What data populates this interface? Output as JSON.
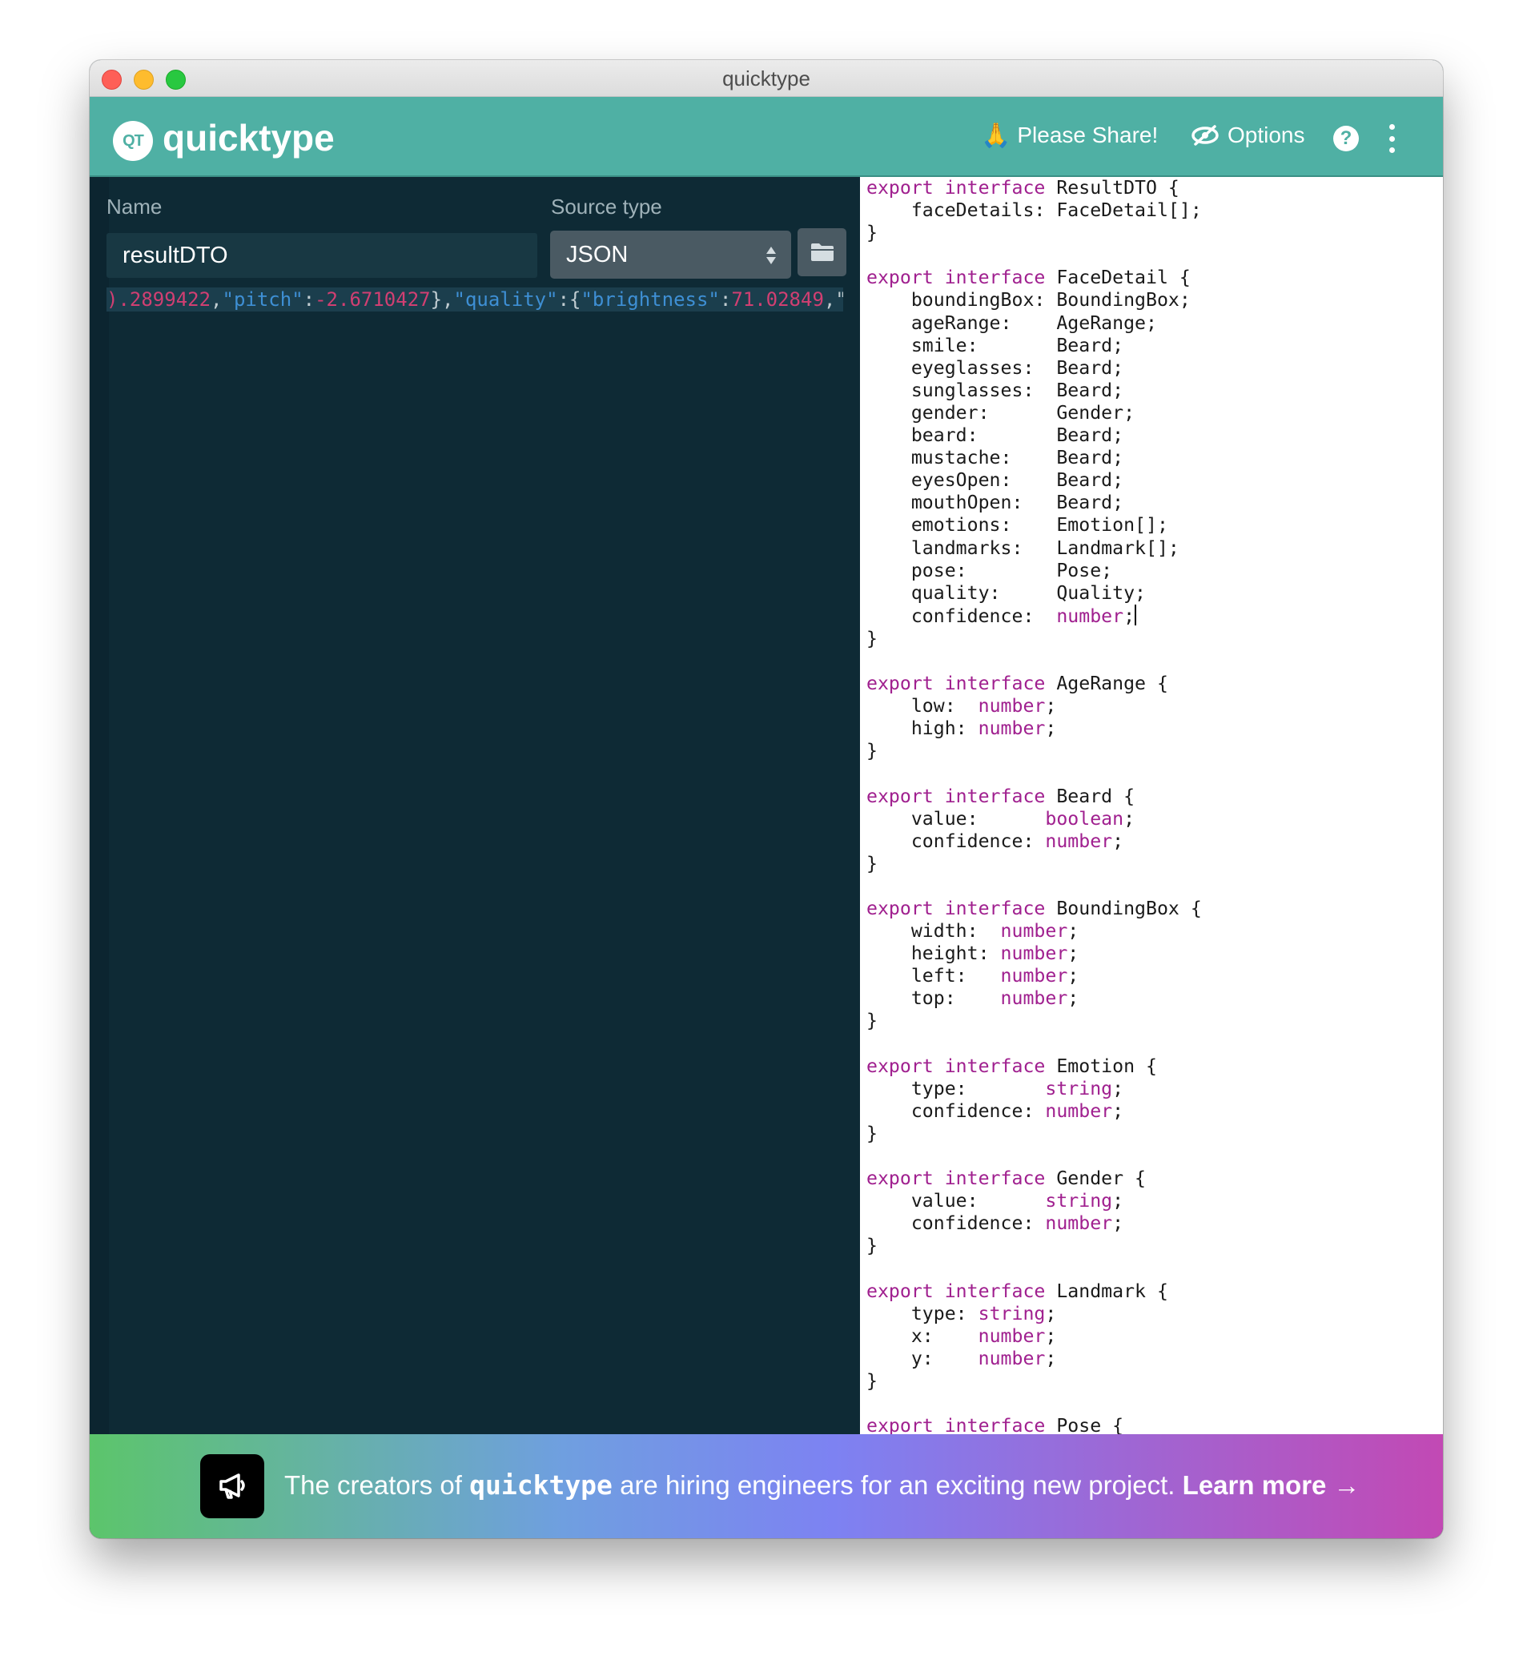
{
  "window": {
    "title": "quicktype"
  },
  "appbar": {
    "logo_badge": "QT",
    "logo_text": "quicktype",
    "share_label": "Please Share!",
    "share_emoji": "🙏",
    "options_label": "Options",
    "help_label": "?",
    "bg_color": "#4fb0a4"
  },
  "left": {
    "name_label": "Name",
    "name_value": "resultDTO",
    "source_label": "Source type",
    "source_value": "JSON",
    "json_tokens": [
      {
        "t": ").2899422",
        "c": "jnum"
      },
      {
        "t": ",",
        "c": "jpunc"
      },
      {
        "t": "\"pitch\"",
        "c": "jkey"
      },
      {
        "t": ":",
        "c": "jpunc"
      },
      {
        "t": "-2.6710427",
        "c": "jnum"
      },
      {
        "t": "},",
        "c": "jpunc"
      },
      {
        "t": "\"quality\"",
        "c": "jkey"
      },
      {
        "t": ":{",
        "c": "jpunc"
      },
      {
        "t": "\"brightness\"",
        "c": "jkey"
      },
      {
        "t": ":",
        "c": "jpunc"
      },
      {
        "t": "71.02849",
        "c": "jnum"
      },
      {
        "t": ",\"",
        "c": "jpunc"
      }
    ]
  },
  "code_lines": [
    [
      [
        "export interface ",
        "kw"
      ],
      [
        "ResultDTO {",
        ""
      ]
    ],
    [
      [
        "    faceDetails: FaceDetail[];",
        ""
      ]
    ],
    [
      [
        "}",
        ""
      ]
    ],
    [
      [
        "",
        ""
      ]
    ],
    [
      [
        "export interface ",
        "kw"
      ],
      [
        "FaceDetail {",
        ""
      ]
    ],
    [
      [
        "    boundingBox: BoundingBox;",
        ""
      ]
    ],
    [
      [
        "    ageRange:    AgeRange;",
        ""
      ]
    ],
    [
      [
        "    smile:       Beard;",
        ""
      ]
    ],
    [
      [
        "    eyeglasses:  Beard;",
        ""
      ]
    ],
    [
      [
        "    sunglasses:  Beard;",
        ""
      ]
    ],
    [
      [
        "    gender:      Gender;",
        ""
      ]
    ],
    [
      [
        "    beard:       Beard;",
        ""
      ]
    ],
    [
      [
        "    mustache:    Beard;",
        ""
      ]
    ],
    [
      [
        "    eyesOpen:    Beard;",
        ""
      ]
    ],
    [
      [
        "    mouthOpen:   Beard;",
        ""
      ]
    ],
    [
      [
        "    emotions:    Emotion[];",
        ""
      ]
    ],
    [
      [
        "    landmarks:   Landmark[];",
        ""
      ]
    ],
    [
      [
        "    pose:        Pose;",
        ""
      ]
    ],
    [
      [
        "    quality:     Quality;",
        ""
      ]
    ],
    [
      [
        "    confidence:  ",
        ""
      ],
      [
        "number",
        "ty"
      ],
      [
        ";",
        "cursor"
      ]
    ],
    [
      [
        "}",
        ""
      ]
    ],
    [
      [
        "",
        ""
      ]
    ],
    [
      [
        "export interface ",
        "kw"
      ],
      [
        "AgeRange {",
        ""
      ]
    ],
    [
      [
        "    low:  ",
        ""
      ],
      [
        "number",
        "ty"
      ],
      [
        ";",
        ""
      ]
    ],
    [
      [
        "    high: ",
        ""
      ],
      [
        "number",
        "ty"
      ],
      [
        ";",
        ""
      ]
    ],
    [
      [
        "}",
        ""
      ]
    ],
    [
      [
        "",
        ""
      ]
    ],
    [
      [
        "export interface ",
        "kw"
      ],
      [
        "Beard {",
        ""
      ]
    ],
    [
      [
        "    value:      ",
        ""
      ],
      [
        "boolean",
        "ty"
      ],
      [
        ";",
        ""
      ]
    ],
    [
      [
        "    confidence: ",
        ""
      ],
      [
        "number",
        "ty"
      ],
      [
        ";",
        ""
      ]
    ],
    [
      [
        "}",
        ""
      ]
    ],
    [
      [
        "",
        ""
      ]
    ],
    [
      [
        "export interface ",
        "kw"
      ],
      [
        "BoundingBox {",
        ""
      ]
    ],
    [
      [
        "    width:  ",
        ""
      ],
      [
        "number",
        "ty"
      ],
      [
        ";",
        ""
      ]
    ],
    [
      [
        "    height: ",
        ""
      ],
      [
        "number",
        "ty"
      ],
      [
        ";",
        ""
      ]
    ],
    [
      [
        "    left:   ",
        ""
      ],
      [
        "number",
        "ty"
      ],
      [
        ";",
        ""
      ]
    ],
    [
      [
        "    top:    ",
        ""
      ],
      [
        "number",
        "ty"
      ],
      [
        ";",
        ""
      ]
    ],
    [
      [
        "}",
        ""
      ]
    ],
    [
      [
        "",
        ""
      ]
    ],
    [
      [
        "export interface ",
        "kw"
      ],
      [
        "Emotion {",
        ""
      ]
    ],
    [
      [
        "    type:       ",
        ""
      ],
      [
        "string",
        "ty"
      ],
      [
        ";",
        ""
      ]
    ],
    [
      [
        "    confidence: ",
        ""
      ],
      [
        "number",
        "ty"
      ],
      [
        ";",
        ""
      ]
    ],
    [
      [
        "}",
        ""
      ]
    ],
    [
      [
        "",
        ""
      ]
    ],
    [
      [
        "export interface ",
        "kw"
      ],
      [
        "Gender {",
        ""
      ]
    ],
    [
      [
        "    value:      ",
        ""
      ],
      [
        "string",
        "ty"
      ],
      [
        ";",
        ""
      ]
    ],
    [
      [
        "    confidence: ",
        ""
      ],
      [
        "number",
        "ty"
      ],
      [
        ";",
        ""
      ]
    ],
    [
      [
        "}",
        ""
      ]
    ],
    [
      [
        "",
        ""
      ]
    ],
    [
      [
        "export interface ",
        "kw"
      ],
      [
        "Landmark {",
        ""
      ]
    ],
    [
      [
        "    type: ",
        ""
      ],
      [
        "string",
        "ty"
      ],
      [
        ";",
        ""
      ]
    ],
    [
      [
        "    x:    ",
        ""
      ],
      [
        "number",
        "ty"
      ],
      [
        ";",
        ""
      ]
    ],
    [
      [
        "    y:    ",
        ""
      ],
      [
        "number",
        "ty"
      ],
      [
        ";",
        ""
      ]
    ],
    [
      [
        "}",
        ""
      ]
    ],
    [
      [
        "",
        ""
      ]
    ],
    [
      [
        "export interface ",
        "kw"
      ],
      [
        "Pose {",
        ""
      ]
    ]
  ],
  "banner": {
    "prefix": "The creators of ",
    "brand": "quicktype",
    "middle": " are hiring engineers for an exciting new project. ",
    "link": "Learn more →"
  }
}
